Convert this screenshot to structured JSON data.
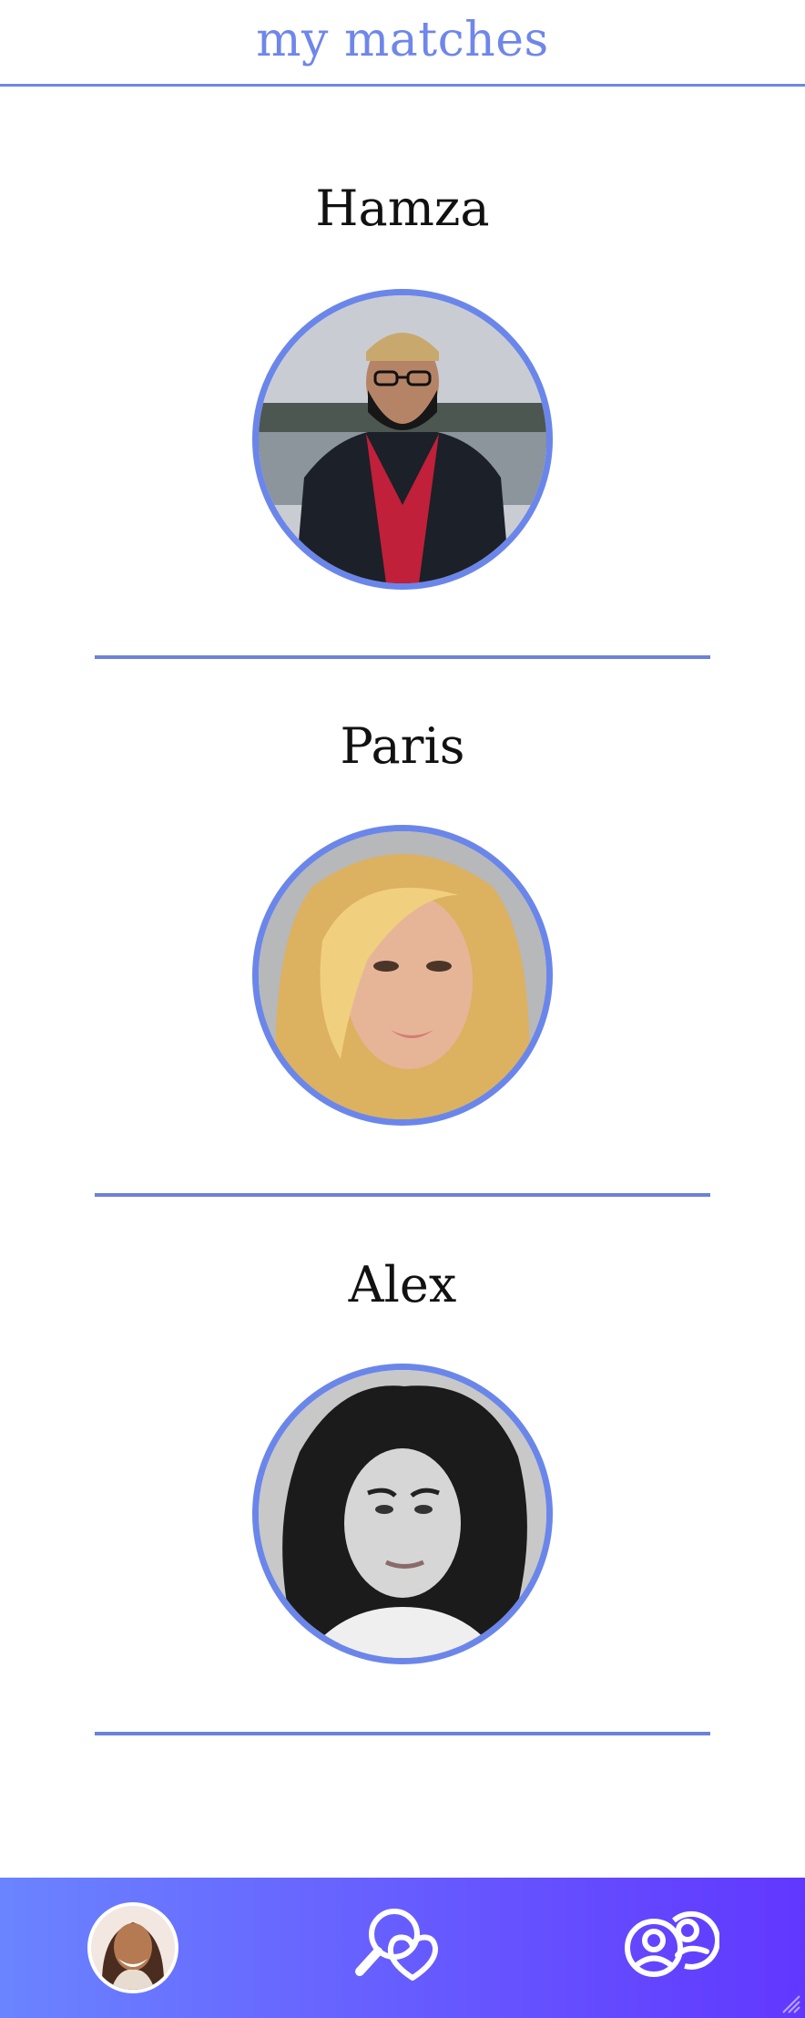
{
  "header": {
    "title": "my matches"
  },
  "matches": [
    {
      "name": "Hamza"
    },
    {
      "name": "Paris"
    },
    {
      "name": "Alex"
    }
  ],
  "nav": {
    "profile": "profile-avatar",
    "search": "search-heart-icon",
    "matches": "people-icon"
  },
  "colors": {
    "accent": "#6b86ea",
    "nav_gradient_start": "#6a84ff",
    "nav_gradient_end": "#6137ff"
  }
}
